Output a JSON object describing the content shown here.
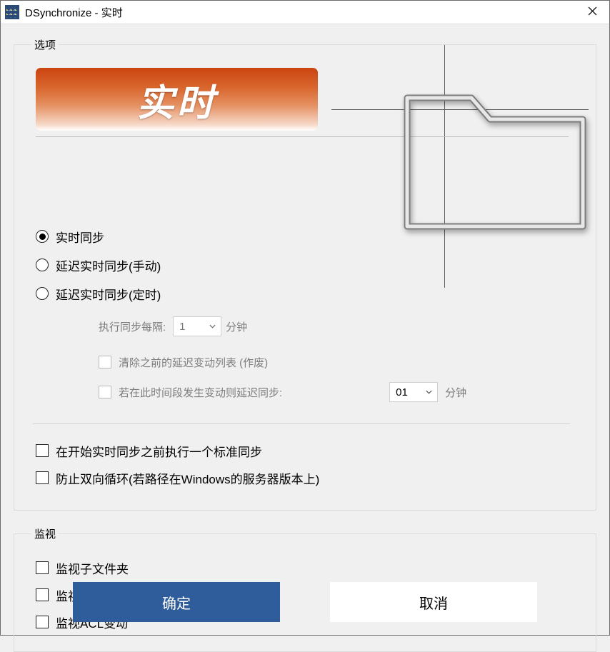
{
  "window": {
    "title": "DSynchronize - 实时"
  },
  "banner": {
    "title": "实时"
  },
  "options": {
    "legend": "选项",
    "radios": {
      "realtime": "实时同步",
      "delayed_manual": "延迟实时同步(手动)",
      "delayed_timed": "延迟实时同步(定时)"
    },
    "interval": {
      "label": "执行同步每隔:",
      "value": "1",
      "unit": "分钟"
    },
    "clear_list": "清除之前的延迟变动列表 (作废)",
    "delay_if_change": {
      "label": "若在此时间段发生变动则延迟同步:",
      "value": "01",
      "unit": "分钟"
    },
    "pre_standard_sync": "在开始实时同步之前执行一个标准同步",
    "prevent_loop": "防止双向循环(若路径在Windows的服务器版本上)"
  },
  "watch": {
    "legend": "监视",
    "subfolders": "监视子文件夹",
    "attributes": "监视属性变动",
    "acl": "监视ACL变动"
  },
  "footer": {
    "ok": "确定",
    "cancel": "取消"
  }
}
